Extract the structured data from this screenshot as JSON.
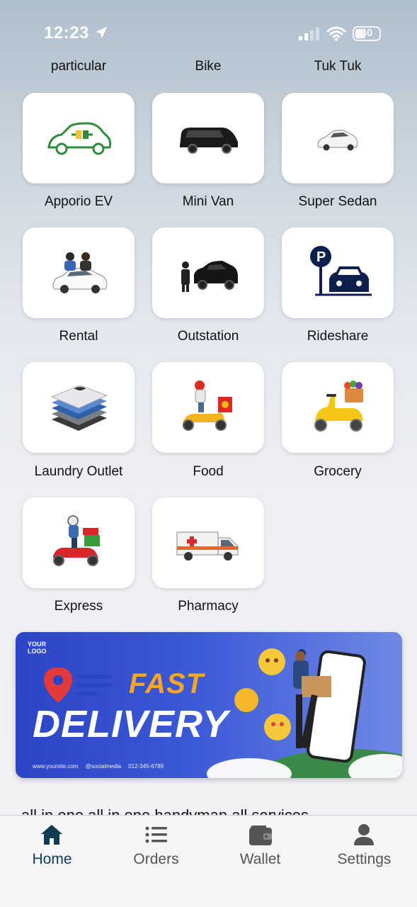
{
  "status_bar": {
    "time": "12:23",
    "battery": "40"
  },
  "cutoff_services": [
    "particular",
    "Bike",
    "Tuk Tuk"
  ],
  "services": [
    {
      "label": "Apporio EV",
      "icon": "ev-car-icon"
    },
    {
      "label": "Mini Van",
      "icon": "minivan-icon"
    },
    {
      "label": "Super Sedan",
      "icon": "sedan-icon"
    },
    {
      "label": "Rental",
      "icon": "rental-car-icon"
    },
    {
      "label": "Outstation",
      "icon": "outstation-car-icon"
    },
    {
      "label": "Rideshare",
      "icon": "parking-car-icon"
    },
    {
      "label": "Laundry Outlet",
      "icon": "folded-clothes-icon"
    },
    {
      "label": "Food",
      "icon": "food-scooter-icon"
    },
    {
      "label": "Grocery",
      "icon": "grocery-scooter-icon"
    },
    {
      "label": "Express",
      "icon": "express-scooter-icon"
    },
    {
      "label": "Pharmacy",
      "icon": "ambulance-icon"
    }
  ],
  "banner": {
    "logo": "YOUR LOGO",
    "fast": "FAST",
    "delivery": "DELIVERY",
    "footer": "www.yoursite.com @socialmedia 012-345-6789"
  },
  "bottom_text": "all in one all in one handyman all services",
  "tabs": [
    {
      "label": "Home",
      "icon": "home-icon",
      "active": true
    },
    {
      "label": "Orders",
      "icon": "list-icon",
      "active": false
    },
    {
      "label": "Wallet",
      "icon": "wallet-icon",
      "active": false
    },
    {
      "label": "Settings",
      "icon": "person-icon",
      "active": false
    }
  ],
  "colors": {
    "active_tab": "#0f3b55",
    "inactive_tab": "#555555",
    "banner_blue": "#2a45c6",
    "fast_orange": "#f6a623"
  }
}
